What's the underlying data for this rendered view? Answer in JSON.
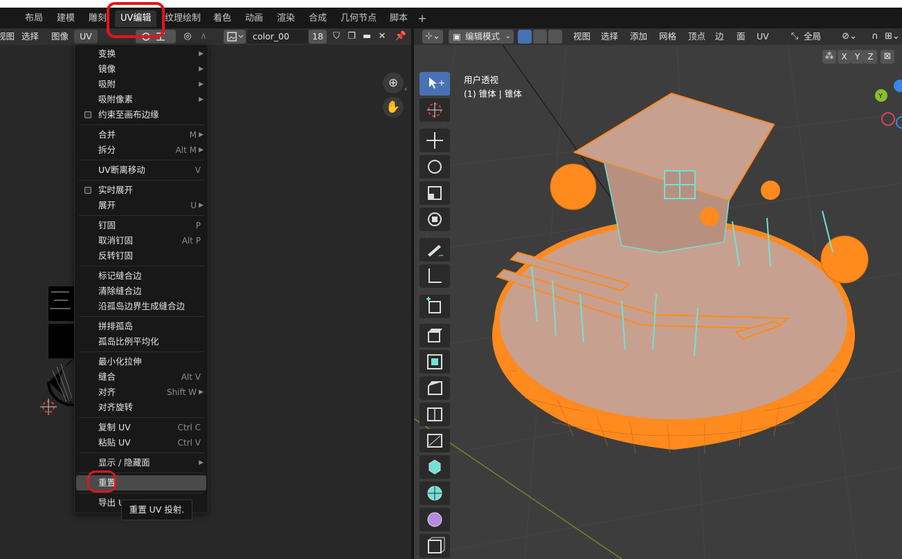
{
  "workspace_tabs": [
    "布局",
    "建模",
    "雕刻",
    "UV编辑",
    "纹理绘制",
    "着色",
    "动画",
    "渲染",
    "合成",
    "几何节点",
    "脚本"
  ],
  "workspace_active": "UV编辑",
  "left_header": {
    "view": "视图",
    "select": "选择",
    "image": "图像",
    "uv": "UV",
    "image_name": "color_00",
    "image_users": "18"
  },
  "uv_menu": {
    "items": [
      {
        "label": "变换",
        "shortcut": "",
        "submenu": true
      },
      {
        "label": "镜像",
        "shortcut": "",
        "submenu": true
      },
      {
        "label": "吸附",
        "shortcut": "",
        "submenu": true
      },
      {
        "label": "吸附像素",
        "shortcut": "",
        "submenu": true
      },
      {
        "label": "约束至画布边缘",
        "checkbox": true
      },
      {
        "label": "合并",
        "shortcut": "M",
        "submenu": true
      },
      {
        "label": "拆分",
        "shortcut": "Alt M",
        "submenu": true
      },
      {
        "label": "UV断离移动",
        "shortcut": "V"
      },
      {
        "label": "实时展开",
        "checkbox": true
      },
      {
        "label": "展开",
        "shortcut": "U",
        "submenu": true
      },
      {
        "label": "钉固",
        "shortcut": "P"
      },
      {
        "label": "取消钉固",
        "shortcut": "Alt P"
      },
      {
        "label": "反转钉固",
        "shortcut": ""
      },
      {
        "label": "标记缝合边"
      },
      {
        "label": "清除缝合边"
      },
      {
        "label": "沿孤岛边界生成缝合边"
      },
      {
        "label": "拼排孤岛"
      },
      {
        "label": "孤岛比例平均化"
      },
      {
        "label": "最小化拉伸"
      },
      {
        "label": "缝合",
        "shortcut": "Alt V"
      },
      {
        "label": "对齐",
        "shortcut": "Shift W",
        "submenu": true
      },
      {
        "label": "对齐旋转"
      },
      {
        "label": "复制 UV",
        "shortcut": "Ctrl C"
      },
      {
        "label": "粘贴 UV",
        "shortcut": "Ctrl V"
      },
      {
        "label": "显示 / 隐藏面",
        "submenu": true
      },
      {
        "label": "重置",
        "highlighted": true
      },
      {
        "label": "导出 U"
      }
    ]
  },
  "tooltip": "重置 UV 投射.",
  "viewport_header": {
    "mode": "编辑模式",
    "menus": [
      "视图",
      "选择",
      "添加",
      "网格",
      "顶点",
      "边",
      "面",
      "UV"
    ],
    "transform_orientation": "全局",
    "mirror_axes": [
      "X",
      "Y",
      "Z"
    ]
  },
  "viewport": {
    "view_name": "用户透视",
    "object_info": "(1) 锥体 | 锥体"
  },
  "colors": {
    "accent": "#4772b3",
    "selection_orange": "#ff8a1e",
    "annotation_red": "#e3141b",
    "edge_cyan": "#6fe3d4"
  }
}
